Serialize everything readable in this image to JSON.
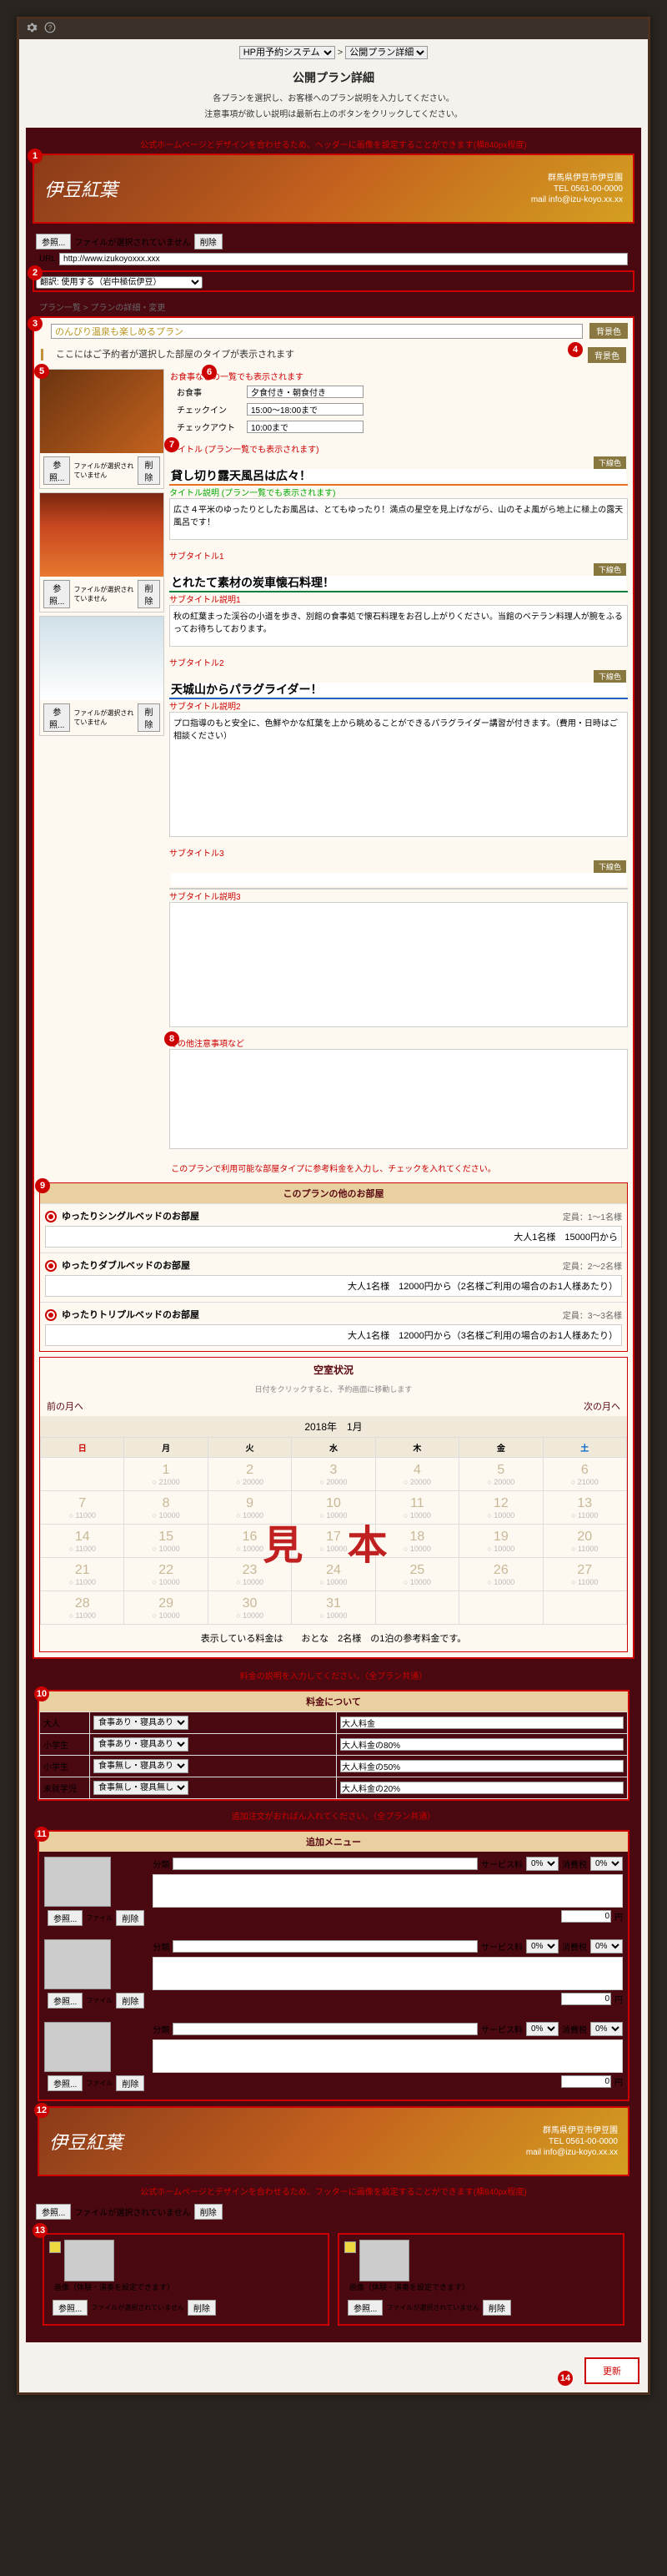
{
  "topbar": {
    "gear_icon": "gear",
    "help_icon": "help"
  },
  "breadcrumb": {
    "system": "HP用予約システム",
    "sep": ">",
    "page": "公開プラン詳細"
  },
  "pagetitle": "公開プラン詳細",
  "notes": [
    "各プランを選択し、お客様へのプラン説明を入力してください。",
    "注意事項が欲しい説明は最新右上のボタンをクリックしてください。"
  ],
  "header": {
    "tip": "公式ホームページとデザインを合わせるため、ヘッダーに画像を設定することができます(横840px程度)",
    "brand": "伊豆紅葉",
    "hotel_label": "群馬県伊豆市伊豆園",
    "tel": "TEL 0561-00-0000",
    "mail": "mail info@izu-koyo.xx.xx",
    "file_btn": "参照...",
    "file_status": "ファイルが選択されていません",
    "del_btn": "削除",
    "url_label": "URL",
    "url_value": "http://www.izukoyoxxx.xxx"
  },
  "translate": {
    "label": "翻訳: 使用する（岩中極伝伊豆）"
  },
  "crumb2": "プラン一覧 > プランの詳細・変更",
  "plan": {
    "name": "のんびり温泉も楽しめるプラン",
    "bg_btn": "背景色",
    "desc": "ここにはご予約者が選択した部屋のタイプが表示されます",
    "meal_tip": "お食事などの一覧でも表示されます",
    "meal_label": "お食事",
    "meal_value": "夕食付き・朝食付き",
    "checkin_label": "チェックイン",
    "checkin_value": "15:00～18:00まで",
    "checkout_label": "チェックアウト",
    "checkout_value": "10:00まで"
  },
  "sec1": {
    "tip": "タイトル (プラン一覧でも表示されます)",
    "tip2": "タイトル説明 (プラン一覧でも表示されます)",
    "title": "貸し切り露天風呂は広々！",
    "line_btn": "下線色",
    "text": "広さ４平米のゆったりとしたお風呂は、とてもゆったり！満点の星空を見上げながら、山のそよ風がら地上に極上の露天風呂です！"
  },
  "sec2": {
    "tip": "サブタイトル1",
    "tip2": "サブタイトル説明1",
    "title": "とれたて素材の炭車懐石料理！",
    "text": "秋の紅葉まった渓谷の小道を歩き、別館の食事処で懐石料理をお召し上がりください。当館のベテラン料理人が腕をふるってお待ちしております。"
  },
  "sec3": {
    "tip": "サブタイトル2",
    "tip2": "サブタイトル説明2",
    "title": "天城山からパラグライダー！",
    "text": "プロ指導のもと安全に、色鮮やかな紅葉を上から眺めることができるパラグライダー講習が付きます。（費用・日時はご相談ください）"
  },
  "sec4": {
    "tip": "サブタイトル3",
    "title": "",
    "tip2": "サブタイトル説明3"
  },
  "sec5": {
    "tip": "その他注意事項など"
  },
  "rooms": {
    "tip": "このプランで利用可能な部屋タイプに参考料金を入力し、チェックを入れてください。",
    "head": "このプランの他のお部屋",
    "items": [
      {
        "name": "ゆったりシングルベッドのお部屋",
        "cap": "定員：1～1名様",
        "price": "大人1名様　15000円から"
      },
      {
        "name": "ゆったりダブルベッドのお部屋",
        "cap": "定員：2～2名様",
        "price": "大人1名様　12000円から（2名様ご利用の場合のお1人様あたり）"
      },
      {
        "name": "ゆったりトリプルベッドのお部屋",
        "cap": "定員：3～3名様",
        "price": "大人1名様　12000円から（3名様ご利用の場合のお1人様あたり）"
      }
    ]
  },
  "calendar": {
    "head": "空室状況",
    "sub": "日付をクリックすると、予約画面に移動します",
    "prev": "前の月へ",
    "next": "次の月へ",
    "month": "2018年　1月",
    "days": [
      "日",
      "月",
      "火",
      "水",
      "木",
      "金",
      "土"
    ],
    "cells": [
      [
        "",
        "1",
        "2",
        "3",
        "4",
        "5",
        "6"
      ],
      [
        "7",
        "8",
        "9",
        "10",
        "11",
        "12",
        "13"
      ],
      [
        "14",
        "15",
        "16",
        "17",
        "18",
        "19",
        "20"
      ],
      [
        "21",
        "22",
        "23",
        "24",
        "25",
        "26",
        "27"
      ],
      [
        "28",
        "29",
        "30",
        "31",
        "",
        "",
        ""
      ]
    ],
    "vals": [
      [
        "",
        "○ 21000",
        "○ 20000",
        "○ 20000",
        "○ 20000",
        "○ 20000",
        "○ 21000"
      ],
      [
        "○ 11000",
        "○ 10000",
        "○ 10000",
        "○ 10000",
        "○ 10000",
        "○ 10000",
        "○ 11000"
      ],
      [
        "○ 11000",
        "○ 10000",
        "○ 10000",
        "○ 10000",
        "○ 10000",
        "○ 10000",
        "○ 11000"
      ],
      [
        "○ 11000",
        "○ 10000",
        "○ 10000",
        "○ 10000",
        "○ 10000",
        "○ 10000",
        "○ 11000"
      ],
      [
        "○ 11000",
        "○ 10000",
        "○ 10000",
        "○ 10000",
        "",
        "",
        ""
      ]
    ],
    "foot_pre": "表示している料金は　　おとな　",
    "foot_cnt": "2名様",
    "foot_post": "　の1泊の参考料金です。"
  },
  "pricing": {
    "tip": "料金の説明を入力してください。（全プラン共通）",
    "head": "料金について",
    "rows": [
      {
        "age": "大人",
        "meal": "食事あり・寝具あり",
        "note": "大人料金"
      },
      {
        "age": "小学生",
        "meal": "食事あり・寝具あり",
        "note": "大人料金の80%"
      },
      {
        "age": "小学生",
        "meal": "食事無し・寝具あり",
        "note": "大人料金の50%"
      },
      {
        "age": "未就学児",
        "meal": "食事無し・寝具無し",
        "note": "大人料金の20%"
      }
    ]
  },
  "addmenu": {
    "tip": "追加注文がおればん入れてください。（全プラン共通）",
    "head": "追加メニュー",
    "cat": "分類",
    "svc": "サービス料",
    "svc_val": "0%",
    "tax": "消費税",
    "tax_val": "0%",
    "price_suffix": "円",
    "file_btn": "参照...",
    "file_none": "ファイル",
    "del": "削除"
  },
  "footer": {
    "brand": "伊豆紅葉",
    "hotel_label": "群馬県伊豆市伊豆園",
    "tel": "TEL 0561-00-0000",
    "mail": "mail info@izu-koyo.xx.xx",
    "tip": "公式ホームページとデザインを合わせるため、フッターに画像を設定することができます(横840px程度)",
    "file_btn": "参照...",
    "file_status": "ファイルが選択されていません",
    "del": "削除"
  },
  "dual": {
    "tip_left": "画像（体験・演奏を設定できます）",
    "tip_right": "画像（体験・演奏を設定できます）",
    "file_btn": "参照...",
    "file_status": "ファイルが選択されていません",
    "del": "削除"
  },
  "final": {
    "btn": "更新"
  }
}
